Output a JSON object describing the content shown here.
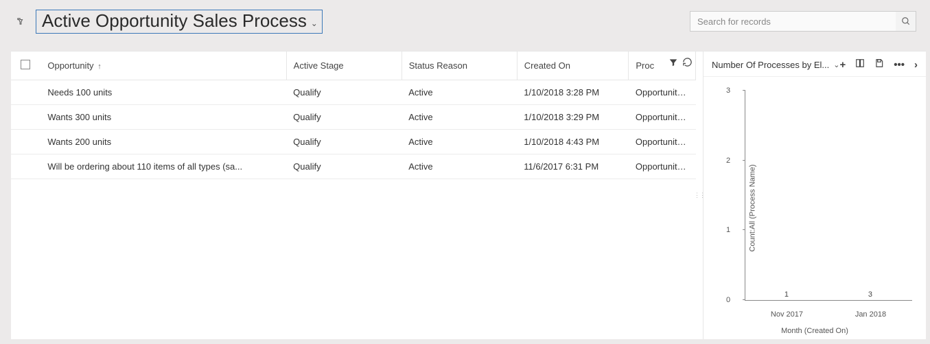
{
  "header": {
    "view_title": "Active Opportunity Sales Process",
    "search_placeholder": "Search for records"
  },
  "grid": {
    "columns": {
      "opportunity": "Opportunity",
      "active_stage": "Active Stage",
      "status_reason": "Status Reason",
      "created_on": "Created On",
      "process": "Proc"
    },
    "rows": [
      {
        "opportunity": "Needs 100 units",
        "stage": "Qualify",
        "status": "Active",
        "created": "1/10/2018 3:28 PM",
        "process": "Opportunity Sa"
      },
      {
        "opportunity": "Wants 300 units",
        "stage": "Qualify",
        "status": "Active",
        "created": "1/10/2018 3:29 PM",
        "process": "Opportunity Sa"
      },
      {
        "opportunity": "Wants 200 units",
        "stage": "Qualify",
        "status": "Active",
        "created": "1/10/2018 4:43 PM",
        "process": "Opportunity Sa"
      },
      {
        "opportunity": "Will be ordering about 110 items of all types (sa...",
        "stage": "Qualify",
        "status": "Active",
        "created": "11/6/2017 6:31 PM",
        "process": "Opportunity Sa"
      }
    ]
  },
  "chart": {
    "title": "Number Of Processes by El...",
    "ylabel": "Count:All (Process Name)",
    "xlabel": "Month (Created On)"
  },
  "chart_data": {
    "type": "bar",
    "categories": [
      "Nov 2017",
      "Jan 2018"
    ],
    "values": [
      1,
      3
    ],
    "title": "Number Of Processes by Elapsed Time",
    "xlabel": "Month (Created On)",
    "ylabel": "Count:All (Process Name)",
    "ylim": [
      0,
      3
    ],
    "yticks": [
      0,
      1,
      2,
      3
    ]
  }
}
